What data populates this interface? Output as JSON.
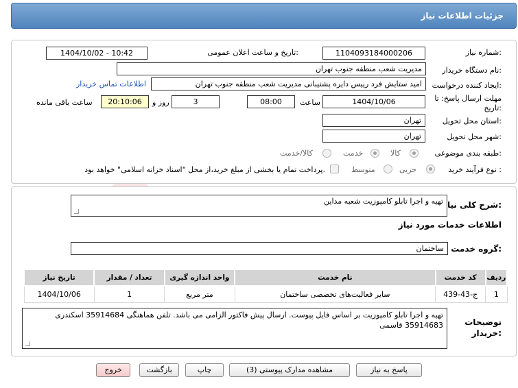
{
  "header": {
    "title": "جزئیات اطلاعات نیاز"
  },
  "form": {
    "need_number_label": "شماره نیاز:",
    "need_number": "1104093184000206",
    "announce_label": "تاریخ و ساعت اعلان عمومی:",
    "announce_value": "1404/10/02 - 10:42",
    "buyer_label": "نام دستگاه خریدار:",
    "buyer_value": "مدیریت شعب منطقه جنوب تهران",
    "creator_label": "ایجاد کننده درخواست:",
    "creator_value": "امید ستایش فرد رییس دایره پشتیبانی مدیریت شعب منطقه جنوب تهران",
    "contact_link": "اطلاعات تماس خریدار",
    "deadline_label": "مهلت ارسال پاسخ: تا تاریخ:",
    "deadline_date": "1404/10/06",
    "time_label": "ساعت",
    "deadline_time": "08:00",
    "days_value": "3",
    "days_label": "روز و",
    "remaining_value": "20:10:06",
    "remaining_label": "ساعت باقی مانده",
    "province_label": "استان محل تحویل:",
    "province_value": "تهران",
    "city_label": "شهر محل تحویل:",
    "city_value": "تهران",
    "category_label": "طبقه بندی موضوعی:",
    "category_options": [
      "کالا",
      "خدمت",
      "کالا/خدمت"
    ],
    "process_label": "نوع فرآیند خرید :",
    "process_options": [
      "جزیی",
      "متوسط"
    ],
    "payment_note": "پرداخت تمام یا بخشی از مبلغ خرید،از محل \"اسناد خزانه اسلامی\" خواهد بود."
  },
  "summary": {
    "label": "شرح کلی نیاز:",
    "value": "تهیه و اجرا تابلو کامپوزیت شعبه مداین"
  },
  "services": {
    "section_title": "اطلاعات خدمات مورد نیاز",
    "group_label": "گروه خدمت:",
    "group_value": "ساختمان",
    "columns": [
      "ردیف",
      "کد خدمت",
      "نام خدمت",
      "واحد اندازه گیری",
      "تعداد / مقدار",
      "تاریخ نیاز"
    ],
    "rows": [
      [
        "1",
        "ج-43-439",
        "سایر فعالیت‌های تخصصی ساختمان",
        "متر مربع",
        "1",
        "1404/10/06"
      ]
    ]
  },
  "buyer_notes": {
    "label": "توضیحات خریدار:",
    "value": "تهیه و اجرا تابلو کامپوزیت بر اساس فایل پیوست. ارسال پیش فاکتور الزامی می باشد. تلفن هماهنگی 35914684 اسکندری 35914683 قاسمی"
  },
  "buttons": {
    "reply": "پاسخ به نیاز",
    "attachments": "مشاهده مدارک پیوستی (3)",
    "print": "چاپ",
    "back": "بازگشت",
    "exit": "خروج"
  },
  "colors": {
    "header_bg": "#5a8cc4",
    "remaining_bg": "#ffffcc",
    "link": "#1a56b8",
    "table_header_bg": "#d4d4d4"
  }
}
